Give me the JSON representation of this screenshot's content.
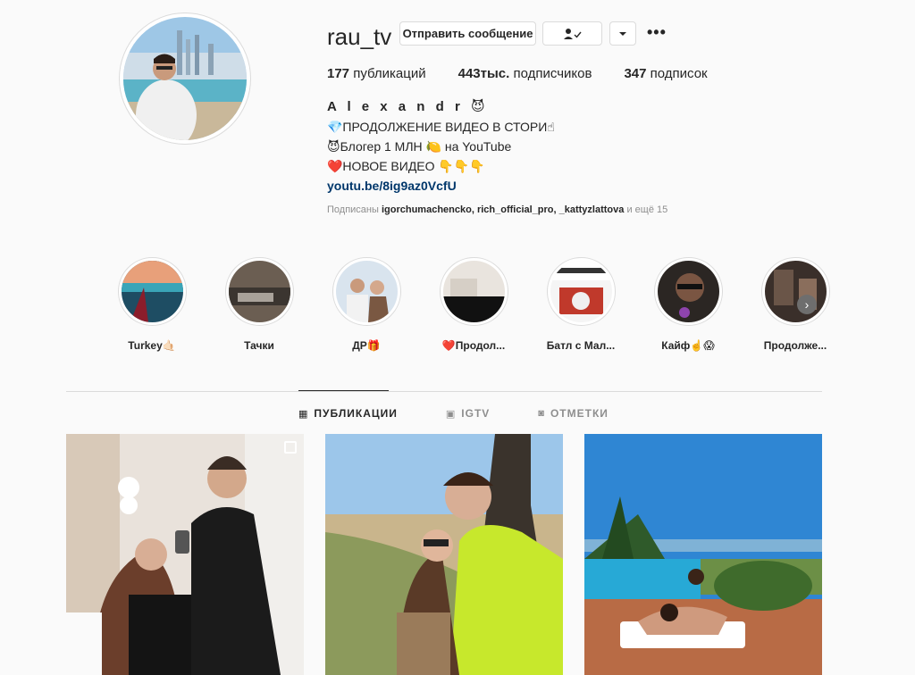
{
  "profile": {
    "username": "rau_tv",
    "message_button": "Отправить сообщение",
    "follow_icon": "person-check-icon",
    "dropdown_icon": "caret-down-icon",
    "more_label": "•••"
  },
  "stats": {
    "posts_count": "177",
    "posts_label": " публикаций",
    "followers_count": "443тыс.",
    "followers_label": " подписчиков",
    "following_count": "347",
    "following_label": " подписок"
  },
  "bio": {
    "name": "A l e x a n d r 😈",
    "line1": "💎ПРОДОЛЖЕНИЕ ВИДЕО В СТОРИ☝",
    "line2": "😈Блогер 1 МЛН 🍋 на YouTube",
    "line3": "❤️НОВОЕ ВИДЕО 👇👇👇",
    "link": "youtu.be/8ig9az0VcfU",
    "followed_prefix": "Подписаны ",
    "followed_users": "igorchumachencko, rich_official_pro, _kattyzlattova",
    "followed_suffix": " и ещё 15"
  },
  "highlights": [
    {
      "label": "Turkey🤙🏻"
    },
    {
      "label": "Тачки"
    },
    {
      "label": "ДР🎁"
    },
    {
      "label": "❤️Продол..."
    },
    {
      "label": "Батл с Мал..."
    },
    {
      "label": "Кайф☝️😱"
    },
    {
      "label": "Продолже..."
    }
  ],
  "tabs": [
    {
      "label": "ПУБЛИКАЦИИ",
      "icon": "grid-icon",
      "glyph": "▦"
    },
    {
      "label": "IGTV",
      "icon": "igtv-icon",
      "glyph": "▣"
    },
    {
      "label": "ОТМЕТКИ",
      "icon": "tagged-icon",
      "glyph": "◙"
    }
  ]
}
